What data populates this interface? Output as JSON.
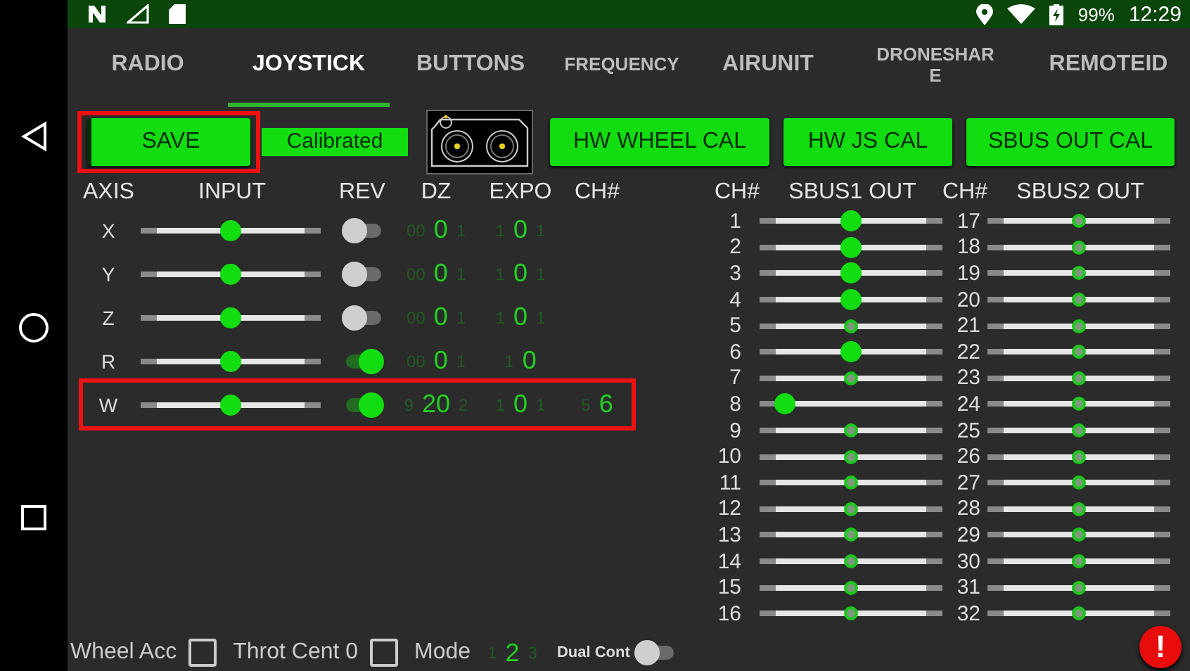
{
  "status_bar": {
    "battery": "99%",
    "time": "12:29"
  },
  "tabs": [
    {
      "label": "RADIO",
      "selected": false
    },
    {
      "label": "JOYSTICK",
      "selected": true
    },
    {
      "label": "BUTTONS",
      "selected": false
    },
    {
      "label": "FREQUENCY",
      "selected": false
    },
    {
      "label": "AIRUNIT",
      "selected": false
    },
    {
      "label": "DRONESHARE",
      "selected": false
    },
    {
      "label": "REMOTEID",
      "selected": false
    }
  ],
  "toolbar": {
    "save": {
      "label": "SAVE",
      "highlighted": true
    },
    "status": "Calibrated",
    "buttons": [
      "HW WHEEL CAL",
      "HW JS CAL",
      "SBUS OUT CAL"
    ]
  },
  "axes": {
    "columns": [
      "AXIS",
      "INPUT",
      "REV",
      "DZ",
      "EXPO",
      "CH#"
    ],
    "rows": [
      {
        "axis": "X",
        "level": 0.5,
        "reversed": false,
        "highlighted": false,
        "dz": {
          "prev": "00",
          "value": "0",
          "next": "1"
        },
        "expo": {
          "prev": "1",
          "value": "0",
          "next": "1"
        }
      },
      {
        "axis": "Y",
        "level": 0.5,
        "reversed": false,
        "highlighted": false,
        "dz": {
          "prev": "00",
          "value": "0",
          "next": "1"
        },
        "expo": {
          "prev": "1",
          "value": "0",
          "next": "1"
        }
      },
      {
        "axis": "Z",
        "level": 0.5,
        "reversed": false,
        "highlighted": false,
        "dz": {
          "prev": "00",
          "value": "0",
          "next": "1"
        },
        "expo": {
          "prev": "1",
          "value": "0",
          "next": "1"
        }
      },
      {
        "axis": "R",
        "level": 0.5,
        "reversed": true,
        "highlighted": false,
        "dz": {
          "prev": "00",
          "value": "0",
          "next": "1"
        },
        "expo": {
          "prev": "1",
          "value": "0"
        }
      },
      {
        "axis": "W",
        "level": 0.5,
        "reversed": true,
        "highlighted": true,
        "dz": {
          "prev": "9",
          "value": "20",
          "next": "2"
        },
        "expo": {
          "prev": "1",
          "value": "0",
          "next": "1"
        },
        "ch": {
          "prev": "5",
          "value": "6"
        }
      }
    ]
  },
  "outputs": {
    "columns": [
      "CH#",
      "SBUS1 OUT",
      "CH#",
      "SBUS2 OUT"
    ],
    "sbus1": [
      {
        "ch": "1",
        "level": 0.5,
        "active": true
      },
      {
        "ch": "2",
        "level": 0.5,
        "active": true
      },
      {
        "ch": "3",
        "level": 0.5,
        "active": true
      },
      {
        "ch": "4",
        "level": 0.5,
        "active": true
      },
      {
        "ch": "5",
        "level": 0.5,
        "active": false
      },
      {
        "ch": "6",
        "level": 0.5,
        "active": true
      },
      {
        "ch": "7",
        "level": 0.5,
        "active": false
      },
      {
        "ch": "8",
        "level": 0.14,
        "active": true
      },
      {
        "ch": "9",
        "level": 0.5,
        "active": false
      },
      {
        "ch": "10",
        "level": 0.5,
        "active": false
      },
      {
        "ch": "11",
        "level": 0.5,
        "active": false
      },
      {
        "ch": "12",
        "level": 0.5,
        "active": false
      },
      {
        "ch": "13",
        "level": 0.5,
        "active": false
      },
      {
        "ch": "14",
        "level": 0.5,
        "active": false
      },
      {
        "ch": "15",
        "level": 0.5,
        "active": false
      },
      {
        "ch": "16",
        "level": 0.5,
        "active": false
      }
    ],
    "sbus2": [
      {
        "ch": "17",
        "level": 0.5,
        "active": false
      },
      {
        "ch": "18",
        "level": 0.5,
        "active": false
      },
      {
        "ch": "19",
        "level": 0.5,
        "active": false
      },
      {
        "ch": "20",
        "level": 0.5,
        "active": false
      },
      {
        "ch": "21",
        "level": 0.5,
        "active": false
      },
      {
        "ch": "22",
        "level": 0.5,
        "active": false
      },
      {
        "ch": "23",
        "level": 0.5,
        "active": false
      },
      {
        "ch": "24",
        "level": 0.5,
        "active": false
      },
      {
        "ch": "25",
        "level": 0.5,
        "active": false
      },
      {
        "ch": "26",
        "level": 0.5,
        "active": false
      },
      {
        "ch": "27",
        "level": 0.5,
        "active": false
      },
      {
        "ch": "28",
        "level": 0.5,
        "active": false
      },
      {
        "ch": "29",
        "level": 0.5,
        "active": false
      },
      {
        "ch": "30",
        "level": 0.5,
        "active": false
      },
      {
        "ch": "31",
        "level": 0.5,
        "active": false
      },
      {
        "ch": "32",
        "level": 0.5,
        "active": false
      }
    ]
  },
  "bottom": [
    {
      "kind": "checkbox",
      "label": "Wheel Acc",
      "checked": false
    },
    {
      "kind": "checkbox",
      "label": "Throt Cent 0",
      "checked": false
    },
    {
      "kind": "picker",
      "label": "Mode",
      "prev": "1",
      "value": "2",
      "next": "3"
    },
    {
      "kind": "switch",
      "label": "Dual Cont",
      "on": false
    }
  ],
  "alert": {
    "label": "!"
  }
}
